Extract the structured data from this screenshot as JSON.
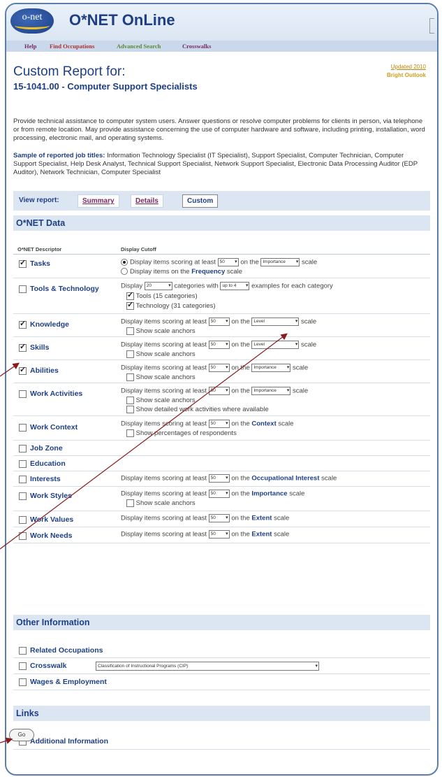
{
  "app": {
    "logo_text": "o-net",
    "title": "O*NET OnLine"
  },
  "nav": {
    "items": [
      "Help",
      "Find Occupations",
      "Advanced Search",
      "Crosswalks"
    ]
  },
  "header": {
    "updated": "Updated 2010",
    "bright": "Bright Outlook",
    "title": "Custom Report for:",
    "subtitle": "15-1041.00 - Computer Support Specialists"
  },
  "description": "Provide technical assistance to computer system users. Answer questions or resolve computer problems for clients in person, via telephone or from remote location. May provide assistance concerning the use of computer hardware and software, including printing, installation, word processing, electronic mail, and operating systems.",
  "samples": {
    "label": "Sample of reported job titles:",
    "text": " Information Technology Specialist (IT Specialist), Support Specialist, Computer Technician, Computer Support Specialist, Help Desk Analyst, Technical Support Specialist, Network Support Specialist, Electronic Data Processing Auditor (EDP Auditor), Network Technician, Computer Specialist"
  },
  "view": {
    "label": "View report:",
    "tabs": [
      "Summary",
      "Details",
      "Custom"
    ],
    "active": "Custom"
  },
  "sections": {
    "onet": "O*NET Data",
    "other": "Other Information",
    "links": "Links"
  },
  "columns": {
    "descriptor": "O*NET Descriptor",
    "cutoff": "Display Cutoff"
  },
  "rows": {
    "tasks": {
      "label": "Tasks",
      "checked": true,
      "opt1_pre": "Display items scoring at least",
      "value": "50",
      "opt1_mid": "on the",
      "scale_sel": "Importance",
      "opt1_post": "scale",
      "opt2_pre": "Display items on the",
      "opt2_bold": "Frequency",
      "opt2_post": "scale"
    },
    "tools": {
      "label": "Tools & Technology",
      "checked": false,
      "pre": "Display",
      "count": "20",
      "mid": "categories with",
      "examples": "up to 4",
      "post": "examples for each category",
      "sub1": "Tools (15 categories)",
      "sub2": "Technology (31 categories)"
    },
    "knowledge": {
      "label": "Knowledge",
      "checked": true,
      "scale": "Level"
    },
    "skills": {
      "label": "Skills",
      "checked": true,
      "scale": "Level"
    },
    "abilities": {
      "label": "Abilities",
      "checked": true,
      "scale": "Importance"
    },
    "work_activities": {
      "label": "Work Activities",
      "checked": false,
      "scale": "Importance",
      "extra": "Show detailed work activities where available"
    },
    "work_context": {
      "label": "Work Context",
      "checked": false,
      "bold": "Context",
      "extra": "Show percentages of respondents"
    },
    "job_zone": {
      "label": "Job Zone",
      "checked": false
    },
    "education": {
      "label": "Education",
      "checked": false
    },
    "interests": {
      "label": "Interests",
      "checked": false,
      "bold": "Occupational Interest"
    },
    "work_styles": {
      "label": "Work Styles",
      "checked": false,
      "bold": "Importance"
    },
    "work_values": {
      "label": "Work Values",
      "checked": false,
      "bold": "Extent"
    },
    "work_needs": {
      "label": "Work Needs",
      "checked": false,
      "bold": "Extent"
    }
  },
  "common": {
    "pre": "Display items scoring at least",
    "value": "50",
    "mid": "on the",
    "post": "scale",
    "anchors": "Show scale anchors"
  },
  "other": {
    "related": "Related Occupations",
    "crosswalk": "Crosswalk",
    "crosswalk_value": "Classification of Instructional Programs (CIP)",
    "wages": "Wages & Employment"
  },
  "links": {
    "additional": "Additional Information"
  },
  "go": "Go"
}
